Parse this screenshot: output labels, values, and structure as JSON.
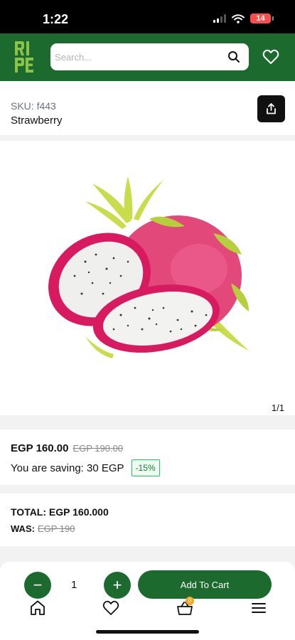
{
  "status_bar": {
    "time": "1:22",
    "battery": "14"
  },
  "header": {
    "logo_text": "RIPE",
    "search": {
      "placeholder": "Search...",
      "value": ""
    }
  },
  "product": {
    "sku": "SKU: f443",
    "name": "Strawberry",
    "image_pager": "1/1"
  },
  "pricing": {
    "current": "EGP 160.00",
    "old": "EGP 190.00",
    "saving": "You are saving: 30 EGP",
    "discount": "-15%"
  },
  "totals": {
    "total": "TOTAL: EGP 160.000",
    "was_label": "WAS:",
    "was_value": "EGP 190"
  },
  "cart": {
    "minus": "−",
    "quantity": "1",
    "plus": "+",
    "add_label": "Add To Cart",
    "badge": "0"
  },
  "icons": {
    "search": "search-icon",
    "wishlist": "heart-icon",
    "share": "share-icon",
    "home": "home-icon",
    "cart": "cart-icon",
    "menu": "menu-icon"
  },
  "colors": {
    "brand_green": "#1d6a2e",
    "badge_orange": "#f5a623",
    "discount_green": "#22c55e"
  }
}
